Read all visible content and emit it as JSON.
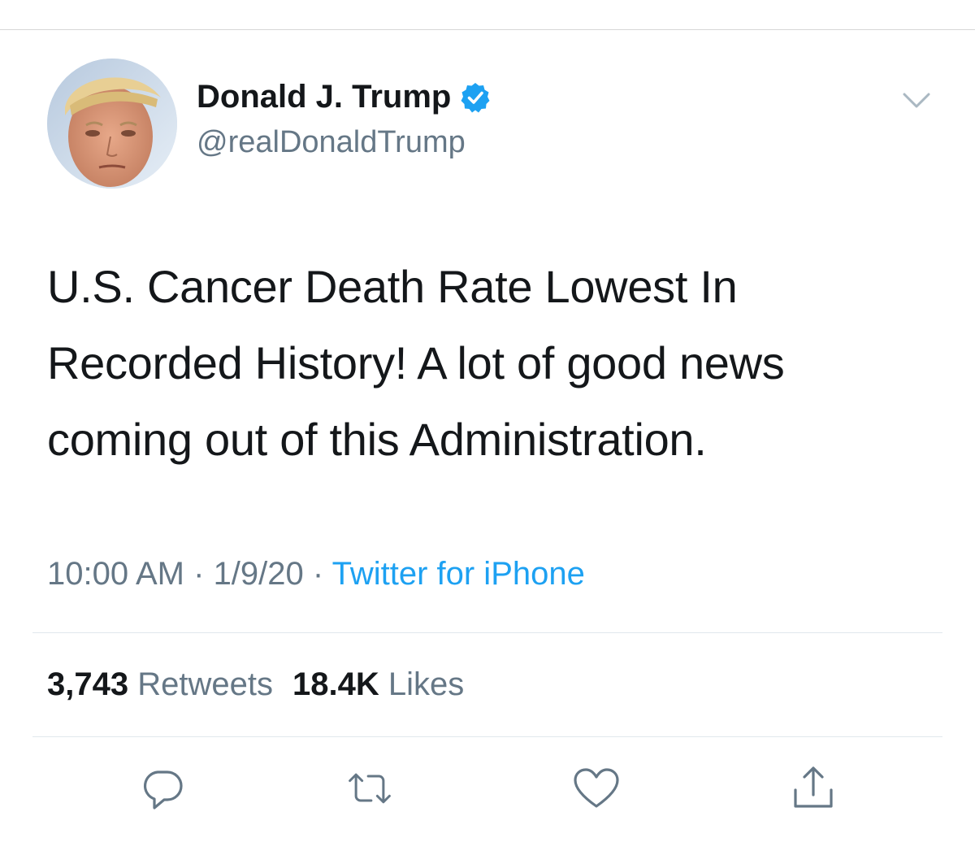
{
  "author": {
    "display_name": "Donald J. Trump",
    "handle": "@realDonaldTrump",
    "verified": true,
    "verified_color": "#1da1f2"
  },
  "tweet": {
    "text": "U.S. Cancer Death Rate Lowest In\nRecorded History! A lot of good news\ncoming out of this Administration."
  },
  "meta": {
    "time": "10:00 AM",
    "separator": " · ",
    "date": "1/9/20",
    "source": "Twitter for iPhone",
    "source_color": "#1da1f2"
  },
  "stats": {
    "retweets_count": "3,743",
    "retweets_label": "Retweets",
    "likes_count": "18.4K",
    "likes_label": "Likes"
  },
  "actions": [
    {
      "name": "reply",
      "icon": "reply-icon"
    },
    {
      "name": "retweet",
      "icon": "retweet-icon"
    },
    {
      "name": "like",
      "icon": "heart-icon"
    },
    {
      "name": "share",
      "icon": "share-icon"
    }
  ],
  "colors": {
    "text": "#14171a",
    "secondary": "#657786",
    "icon": "#657786",
    "divider": "#e1e8ed"
  }
}
